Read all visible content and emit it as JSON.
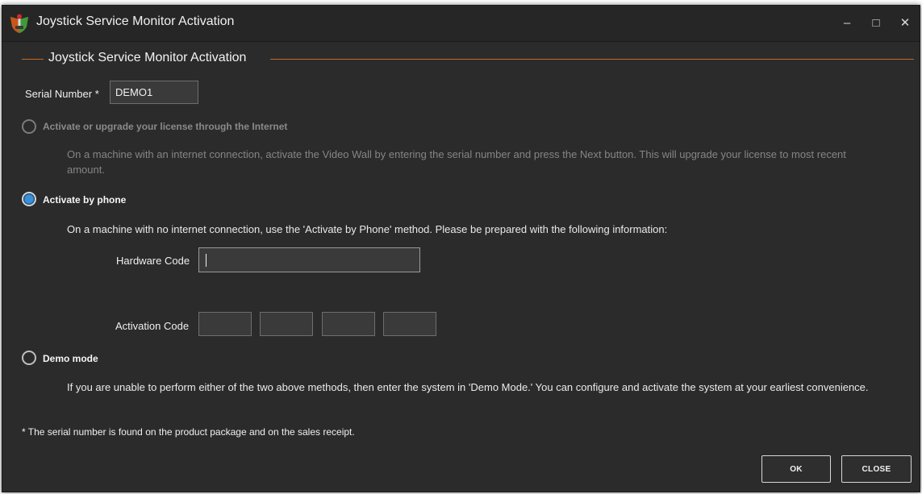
{
  "window": {
    "title": "Joystick Service Monitor Activation",
    "minimize_glyph": "–",
    "maximize_glyph": "□",
    "close_glyph": "✕"
  },
  "group": {
    "title": "Joystick Service Monitor Activation"
  },
  "serial": {
    "label": "Serial Number *",
    "value": "DEMO1"
  },
  "options": {
    "internet": {
      "label": "Activate or upgrade your license through the Internet",
      "description": "On a machine with an internet connection, activate the Video Wall by entering the serial number and press the Next button.  This will upgrade your license to most recent amount.",
      "selected": false,
      "enabled": false
    },
    "phone": {
      "label": "Activate by phone",
      "description": "On a machine with no internet connection, use the 'Activate by Phone' method.  Please be prepared with the following information:",
      "selected": true,
      "enabled": true
    },
    "demo": {
      "label": "Demo mode",
      "description": "If you are unable to perform either of the two above methods, then enter the system in 'Demo Mode.'  You can configure and activate the system at your earliest convenience.",
      "selected": false,
      "enabled": true
    }
  },
  "hardware_code": {
    "label": "Hardware Code",
    "value": ""
  },
  "activation_code": {
    "label": "Activation Code",
    "values": [
      "",
      "",
      "",
      ""
    ]
  },
  "footnote": "* The serial number is found on the product package and on the sales receipt.",
  "buttons": {
    "ok": "OK",
    "close": "CLOSE"
  },
  "colors": {
    "background": "#2b2b2b",
    "accent": "#c26a22",
    "radio_selected": "#3a8fd6",
    "disabled_text": "#858585"
  },
  "icons": {
    "app": "joystick-shield-icon",
    "minimize": "minimize-icon",
    "maximize": "maximize-icon",
    "close": "close-icon"
  }
}
